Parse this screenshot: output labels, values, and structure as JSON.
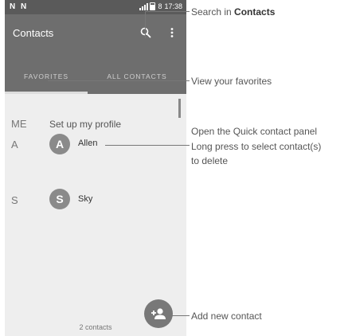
{
  "status_bar": {
    "left_icons": "N N",
    "battery": "8",
    "time": "17:38"
  },
  "app_bar": {
    "title": "Contacts"
  },
  "tabs": [
    {
      "label": "FAVORITES"
    },
    {
      "label": "ALL CONTACTS"
    }
  ],
  "list": {
    "me": {
      "letter": "ME",
      "label": "Set up my profile"
    },
    "contacts": [
      {
        "section": "A",
        "initial": "A",
        "name": "Allen"
      },
      {
        "section": "S",
        "initial": "S",
        "name": "Sky"
      }
    ]
  },
  "footer": {
    "count_text": "2 contacts"
  },
  "callouts": {
    "search_prefix": "Search in ",
    "search_bold": "Contacts",
    "favorites": "View your favorites",
    "quick_panel": "Open the Quick contact panel",
    "long_press_1": "Long press to select contact(s)",
    "long_press_2": "to delete",
    "add_contact": "Add new contact"
  },
  "colors": {
    "appbar": "#6e6e6e",
    "statusbar": "#5a5a5a",
    "background": "#eeeeee",
    "avatar": "#8a8a8a",
    "fab": "#787878"
  }
}
